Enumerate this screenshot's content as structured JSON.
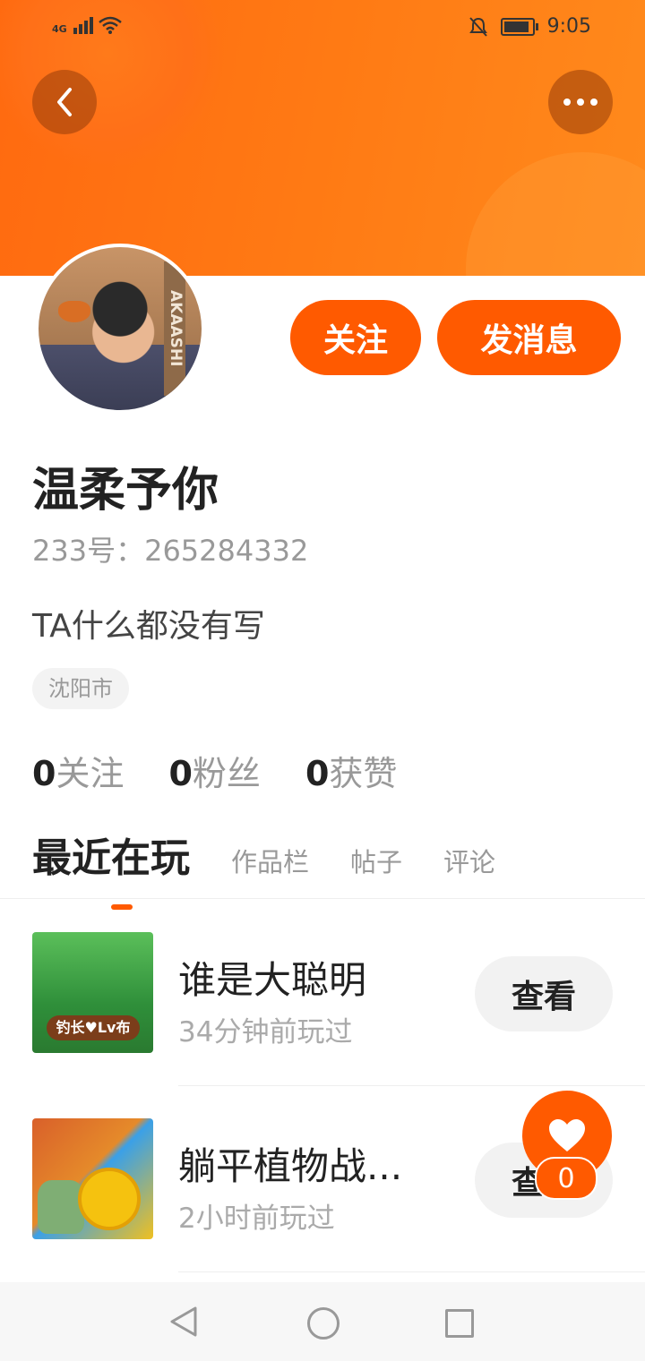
{
  "status_bar": {
    "network": "4G",
    "time": "9:05",
    "signal_icon": "signal-bars-icon",
    "wifi_icon": "wifi-icon",
    "mute_icon": "bell-off-icon",
    "battery_icon": "battery-icon",
    "battery_level": 0.8
  },
  "header": {
    "back_icon": "chevron-left-icon",
    "more_icon": "more-dots-icon",
    "accent_color": "#ff5a00"
  },
  "profile": {
    "follow_label": "关注",
    "message_label": "发消息",
    "username": "温柔予你",
    "uid_text": "233号：265284332",
    "bio": "TA什么都没有写",
    "location_tag": "沈阳市",
    "avatar_text": "AKAASHI"
  },
  "stats": [
    {
      "num": "0",
      "label": "关注"
    },
    {
      "num": "0",
      "label": "粉丝"
    },
    {
      "num": "0",
      "label": "获赞"
    }
  ],
  "tabs": {
    "active": "最近在玩",
    "others": [
      "作品栏",
      "帖子",
      "评论"
    ]
  },
  "games": [
    {
      "title": "谁是大聪明",
      "subtitle": "34分钟前玩过",
      "button": "查看",
      "thumb_label": "钓长♥Lv布"
    },
    {
      "title": "躺平植物战...",
      "subtitle": "2小时前玩过",
      "button": "查看"
    }
  ],
  "floating": {
    "icon": "heart-icon",
    "count": "0"
  },
  "nav": {
    "back_icon": "triangle-back-icon",
    "home_icon": "circle-home-icon",
    "recent_icon": "square-recent-icon"
  }
}
